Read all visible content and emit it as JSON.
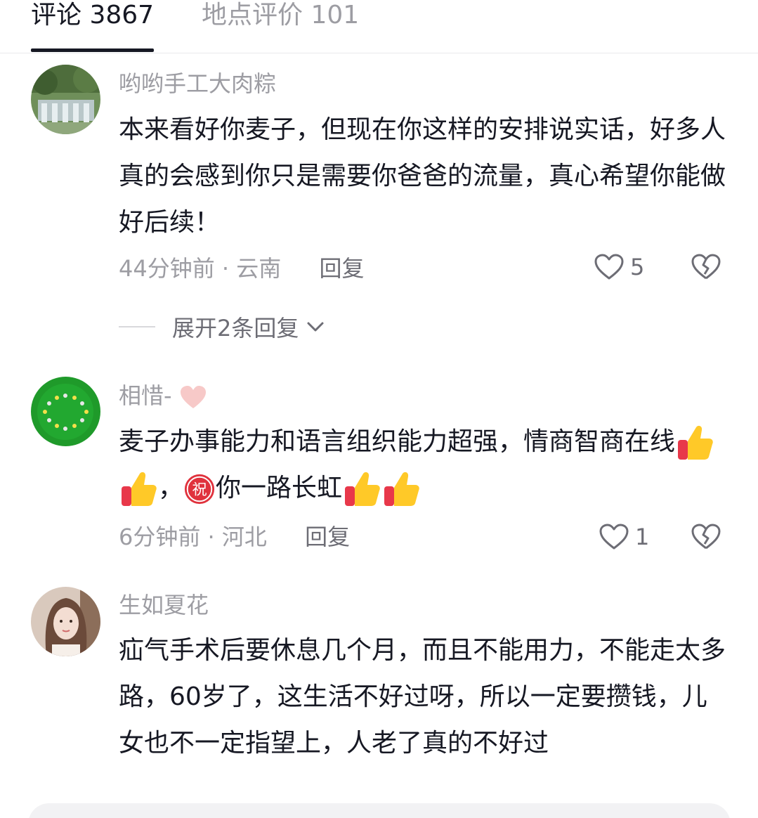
{
  "tabs": [
    {
      "label": "评论 3867",
      "active": true
    },
    {
      "label": "地点评价 101",
      "active": false
    }
  ],
  "comments": [
    {
      "username": "哟哟手工大肉粽",
      "text": "本来看好你麦子，但现在你这样的安排说实话，好多人真的会感到你只是需要你爸爸的流量，真心希望你能做好后续！",
      "time": "44分钟前",
      "location": "云南",
      "reply_label": "回复",
      "likes": "5",
      "expand_label": "展开2条回复"
    },
    {
      "username": "相惜-",
      "username_emoji": "pink-heart",
      "text_part1": "麦子办事能力和语言组织能力超强，情商智商在线",
      "text_part2": "，",
      "text_part3": "你一路长虹",
      "emoji_wish": "祝",
      "time": "6分钟前",
      "location": "河北",
      "reply_label": "回复",
      "likes": "1"
    },
    {
      "username": "生如夏花",
      "text": "疝气手术后要休息几个月，而且不能用力，不能走太多路，60岁了，这生活不好过呀，所以一定要攒钱，儿女也不一定指望上，人老了真的不好过"
    }
  ],
  "colors": {
    "primary_text": "#161823",
    "secondary_text": "#9d9da3",
    "divider": "#e9e9ec"
  },
  "icons": [
    "heart-outline-icon",
    "broken-heart-icon",
    "chevron-down-icon",
    "thumbs-up-emoji",
    "wish-emoji",
    "pink-heart-emoji"
  ]
}
